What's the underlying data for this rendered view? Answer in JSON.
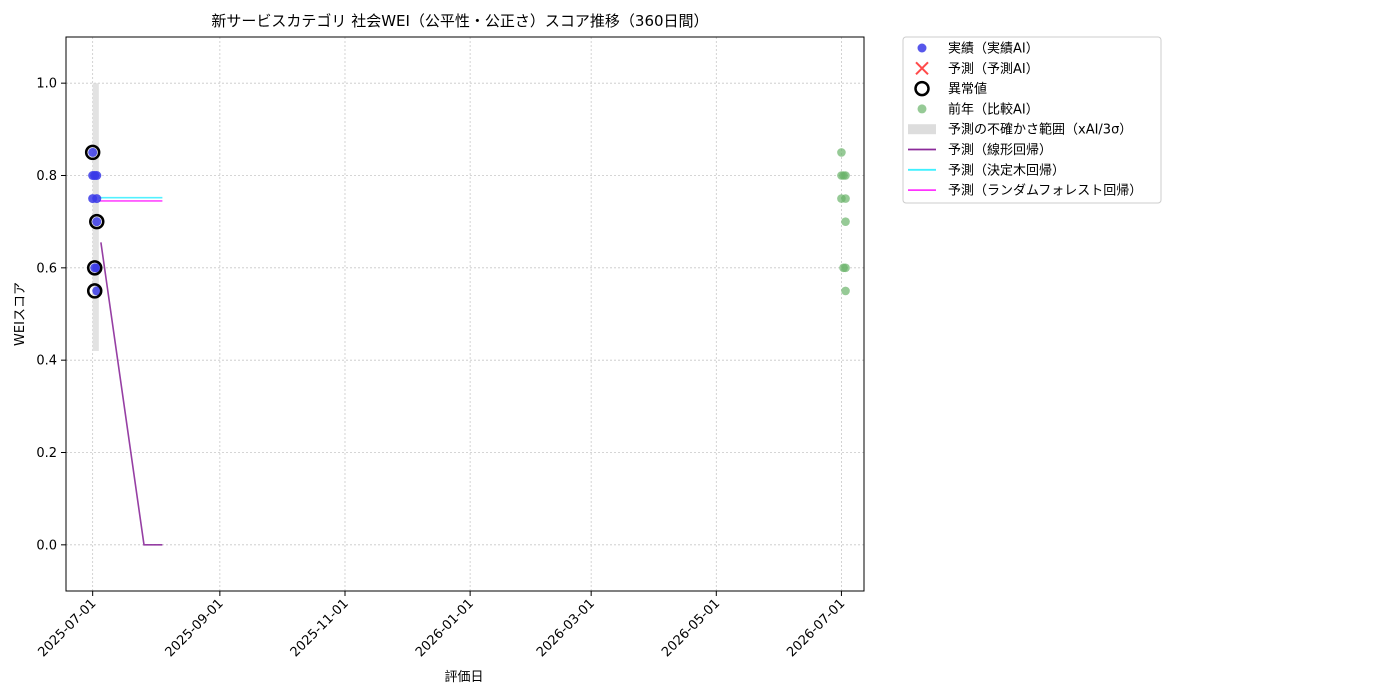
{
  "chart_data": {
    "type": "scatter",
    "title": "新サービスカテゴリ 社会WEI（公平性・公正さ）スコア推移（360日間）",
    "xlabel": "評価日",
    "ylabel": "WEIスコア",
    "xlim": [
      "2025-06-18",
      "2026-07-12"
    ],
    "ylim": [
      -0.1,
      1.1
    ],
    "xticks": [
      "2025-07-01",
      "2025-09-01",
      "2025-11-01",
      "2026-01-01",
      "2026-03-01",
      "2026-05-01",
      "2026-07-01"
    ],
    "yticks": [
      "0.0",
      "0.2",
      "0.4",
      "0.6",
      "0.8",
      "1.0"
    ],
    "grid": true,
    "legend_position": "outside-upper-right",
    "legend": [
      {
        "key": "actual",
        "label": "実績（実績AI）",
        "marker": "circle",
        "color": "#3a3ae8"
      },
      {
        "key": "forecast",
        "label": "予測（予測AI）",
        "marker": "x",
        "color": "#ff4a4a"
      },
      {
        "key": "anomaly",
        "label": "異常値",
        "marker": "ring",
        "color": "#000000"
      },
      {
        "key": "last_year",
        "label": "前年（比較AI）",
        "marker": "circle",
        "color": "#6ab46a"
      },
      {
        "key": "band",
        "label": "予測の不確かさ範囲（xAI/3σ）",
        "marker": "patch",
        "color": "#dddddd"
      },
      {
        "key": "linear",
        "label": "予測（線形回帰）",
        "marker": "line",
        "color": "#8b2a9a"
      },
      {
        "key": "tree",
        "label": "予測（決定木回帰）",
        "marker": "line",
        "color": "#3ff0ff"
      },
      {
        "key": "forest",
        "label": "予測（ランダムフォレスト回帰）",
        "marker": "line",
        "color": "#ff33ff"
      }
    ],
    "series": [
      {
        "key": "actual",
        "points": [
          {
            "x": "2025-07-01",
            "y": 0.85
          },
          {
            "x": "2025-07-01",
            "y": 0.8
          },
          {
            "x": "2025-07-02",
            "y": 0.8
          },
          {
            "x": "2025-07-03",
            "y": 0.8
          },
          {
            "x": "2025-07-01",
            "y": 0.75
          },
          {
            "x": "2025-07-03",
            "y": 0.75
          },
          {
            "x": "2025-07-03",
            "y": 0.7
          },
          {
            "x": "2025-07-02",
            "y": 0.6
          },
          {
            "x": "2025-07-03",
            "y": 0.6
          },
          {
            "x": "2025-07-03",
            "y": 0.55
          }
        ]
      },
      {
        "key": "anomaly",
        "points": [
          {
            "x": "2025-07-01",
            "y": 0.85
          },
          {
            "x": "2025-07-03",
            "y": 0.7
          },
          {
            "x": "2025-07-02",
            "y": 0.6
          },
          {
            "x": "2025-07-02",
            "y": 0.55
          }
        ]
      },
      {
        "key": "last_year",
        "points": [
          {
            "x": "2026-07-01",
            "y": 0.85
          },
          {
            "x": "2026-07-01",
            "y": 0.8
          },
          {
            "x": "2026-07-02",
            "y": 0.8
          },
          {
            "x": "2026-07-03",
            "y": 0.8
          },
          {
            "x": "2026-07-01",
            "y": 0.75
          },
          {
            "x": "2026-07-03",
            "y": 0.75
          },
          {
            "x": "2026-07-03",
            "y": 0.7
          },
          {
            "x": "2026-07-02",
            "y": 0.6
          },
          {
            "x": "2026-07-03",
            "y": 0.6
          },
          {
            "x": "2026-07-03",
            "y": 0.55
          }
        ]
      },
      {
        "key": "band",
        "x_from": "2025-07-01",
        "x_to": "2025-07-04",
        "y_low": 0.42,
        "y_high": 1.0
      },
      {
        "key": "linear",
        "points": [
          {
            "x": "2025-07-05",
            "y": 0.655
          },
          {
            "x": "2025-07-26",
            "y": 0.0
          },
          {
            "x": "2025-08-04",
            "y": 0.0
          }
        ]
      },
      {
        "key": "tree",
        "points": [
          {
            "x": "2025-07-04",
            "y": 0.752
          },
          {
            "x": "2025-08-04",
            "y": 0.752
          }
        ]
      },
      {
        "key": "forest",
        "points": [
          {
            "x": "2025-07-04",
            "y": 0.745
          },
          {
            "x": "2025-08-04",
            "y": 0.745
          }
        ]
      }
    ]
  }
}
